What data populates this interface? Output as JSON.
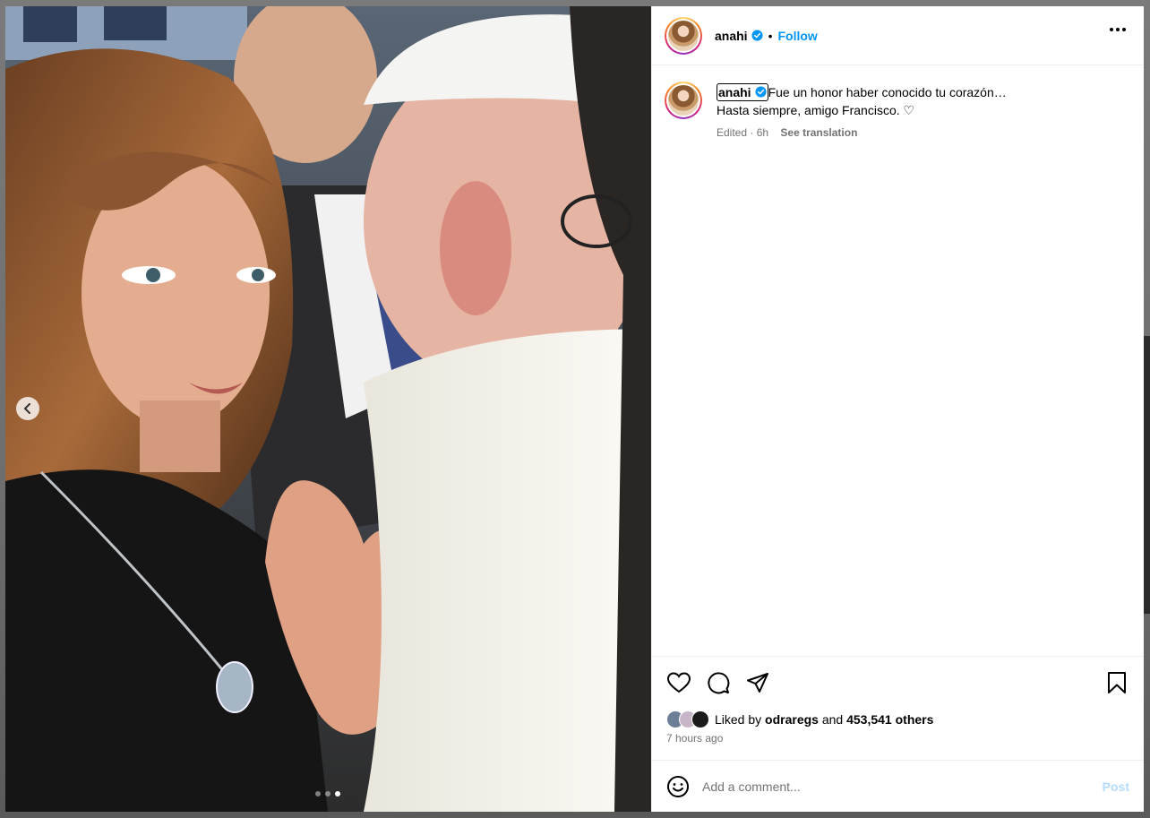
{
  "post": {
    "username": "anahi",
    "follow_label": "Follow",
    "separator": "•",
    "caption": {
      "username": "anahi",
      "line1": "Fue un honor haber conocido tu corazón…",
      "line2": "Hasta siempre, amigo Francisco. ♡",
      "edited": "Edited · 6h",
      "see_translation": "See translation"
    },
    "likes": {
      "prefix": "Liked by",
      "first_liker": "odraregs",
      "and": "and",
      "others": "453,541 others"
    },
    "time_ago": "7 hours ago",
    "comment_placeholder": "Add a comment...",
    "post_label": "Post",
    "carousel": {
      "slides": 3,
      "active_index": 2
    }
  },
  "icons": {
    "verified": "verified-badge-icon",
    "more": "more-options-icon",
    "prev": "chevron-left-icon",
    "like": "heart-icon",
    "comment": "comment-icon",
    "share": "share-icon",
    "save": "bookmark-icon",
    "emoji": "emoji-icon"
  },
  "colors": {
    "accent": "#0095f6",
    "muted": "#737373",
    "post_disabled": "#b3dbff"
  }
}
